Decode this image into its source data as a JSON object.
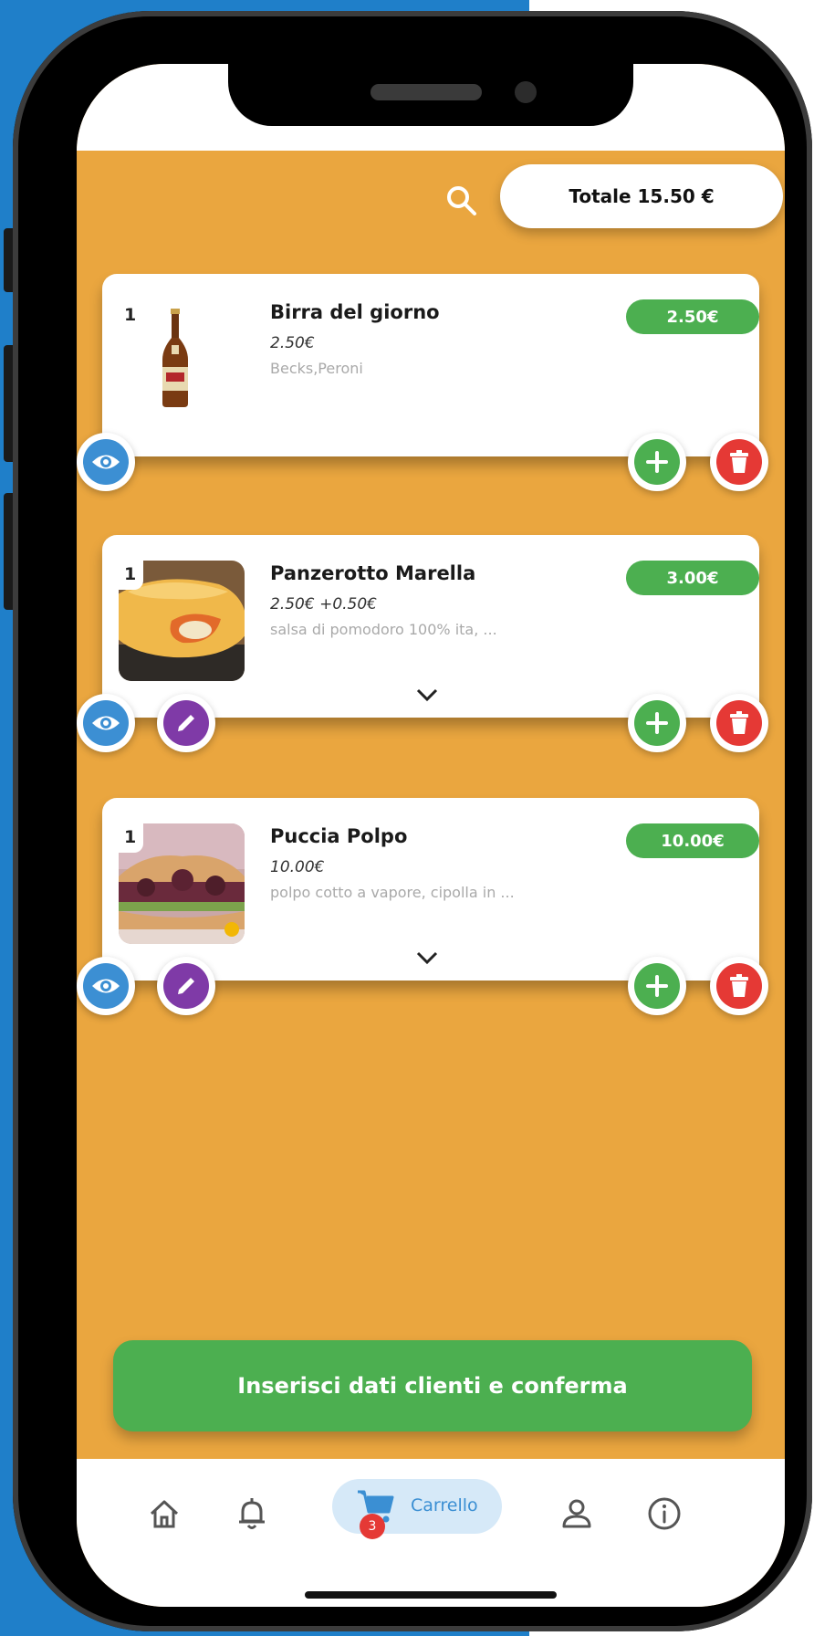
{
  "header": {
    "total_label": "Totale 15.50 €"
  },
  "cart": {
    "items": [
      {
        "qty": "1",
        "name": "Birra del giorno",
        "price_detail": "2.50€",
        "description": "Becks,Peroni",
        "total_badge": "2.50€"
      },
      {
        "qty": "1",
        "name": "Panzerotto Marella",
        "price_detail": "2.50€ +0.50€",
        "description": "salsa di pomodoro 100% ita, ...",
        "total_badge": "3.00€"
      },
      {
        "qty": "1",
        "name": "Puccia Polpo",
        "price_detail": "10.00€",
        "description": "polpo cotto a vapore, cipolla in ...",
        "total_badge": "10.00€"
      }
    ]
  },
  "cta": {
    "label": "Inserisci dati clienti e conferma"
  },
  "navbar": {
    "active_label": "Carrello",
    "cart_count": "3",
    "items": [
      "home-icon",
      "bell-icon",
      "cart-icon",
      "user-icon",
      "info-icon"
    ]
  },
  "colors": {
    "background": "#eaa63f",
    "accent_green": "#4caf50",
    "accent_blue": "#3c8fd3",
    "accent_purple": "#7f3aa7",
    "accent_red": "#e53935"
  }
}
